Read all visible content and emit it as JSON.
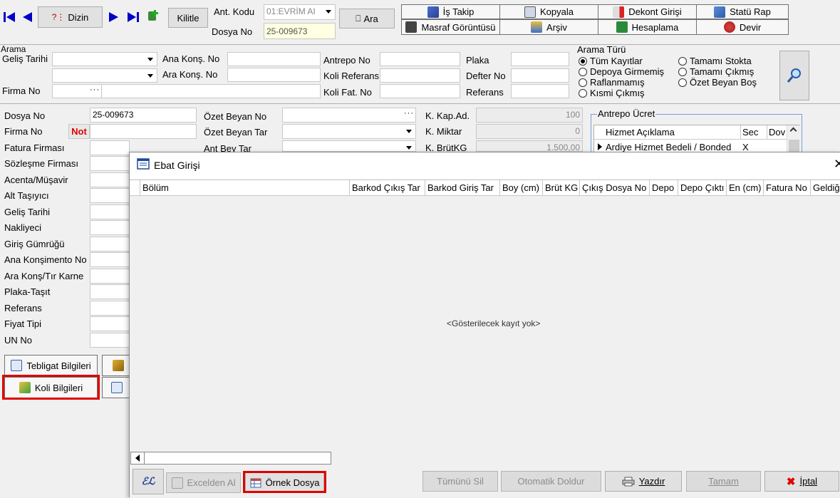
{
  "toolbar": {
    "dizin": "Dizin",
    "kilitle": "Kilitle",
    "ant_kodu_label": "Ant. Kodu",
    "ant_kodu_value": "01:EVRİM AI",
    "dosya_no_label": "Dosya No",
    "dosya_no_value": "25-009673",
    "ara": "Ara",
    "actions": {
      "is_takip": "İş Takip",
      "kopyala": "Kopyala",
      "dekont_girisi": "Dekont Girişi",
      "statu_rap": "Statü Rap",
      "masraf_goruntusu": "Masraf Görüntüsü",
      "arsiv": "Arşiv",
      "hesaplama": "Hesaplama",
      "devir": "Devir"
    }
  },
  "search": {
    "title": "Arama",
    "gelis_tarihi": "Geliş Tarihi",
    "firma_no": "Firma No",
    "ana_kons_no": "Ana Konş. No",
    "ara_kons_no": "Ara Konş. No",
    "antrepo_no": "Antrepo No",
    "koli_referans": "Koli Referans",
    "koli_fat_no": "Koli Fat. No",
    "plaka": "Plaka",
    "defter_no": "Defter No",
    "referans": "Referans",
    "arama_turu": {
      "title": "Arama Türü",
      "options": [
        "Tüm Kayıtlar",
        "Depoya Girmemiş",
        "Raflanmamış",
        "Kısmi Çıkmış",
        "Tamamı Stokta",
        "Tamamı Çıkmış",
        "Özet Beyan Boş"
      ],
      "selected": "Tüm Kayıtlar"
    }
  },
  "form": {
    "labels": [
      "Dosya No",
      "Firma No",
      "Fatura Firması",
      "Sözleşme Firması",
      "Acenta/Müşavir",
      "Alt Taşıyıcı",
      "Geliş Tarihi",
      "Nakliyeci",
      "Giriş Gümrüğü",
      "Ana Konşimento No",
      "Ara Konş/Tır Karne",
      "Plaka-Taşıt",
      "Referans",
      "Fiyat Tipi",
      "UN No"
    ],
    "dosya_no_value": "25-009673",
    "not_badge": "Not",
    "ozet_beyan_no": "Özet Beyan No",
    "ozet_beyan_tar": "Özet Beyan Tar",
    "ant_bey_tar": "Ant Bey Tar",
    "k_kap_ad": "K. Kap.Ad.",
    "k_kap_ad_value": "100",
    "k_miktar": "K. Miktar",
    "k_miktar_value": "0",
    "k_brutkg": "K. BrütKG",
    "k_brutkg_value": "1.500,00",
    "tebligat_bilgileri": "Tebligat Bilgileri",
    "koli_bilgileri": "Koli Bilgileri"
  },
  "antrepo_ucret": {
    "title": "Antrepo Ücret",
    "columns": [
      "Hizmet Açıklama",
      "Sec",
      "Dov"
    ],
    "rows": [
      {
        "hizmet": "Ardiye Hizmet Bedeli / Bonded",
        "sec": "X"
      }
    ]
  },
  "modal": {
    "title": "Ebat Girişi",
    "columns": [
      "Bölüm",
      "Barkod Çıkış Tar",
      "Barkod Giriş Tar",
      "Boy (cm)",
      "Brüt KG",
      "Çıkış Dosya No",
      "Depo",
      "Depo Çıktı",
      "En (cm)",
      "Fatura No",
      "Geldiğ"
    ],
    "empty_text": "<Gösterilecek kayıt yok>",
    "buttons": {
      "excelden_al": "Excelden Al",
      "ornek_dosya": "Örnek Dosya",
      "tumunu_sil": "Tümünü Sil",
      "otomatik_doldur": "Otomatik Doldur",
      "yazdir": "Yazdır",
      "tamam": "Tamam",
      "iptal": "İptal"
    }
  },
  "colors": {
    "highlight": "#e00000",
    "nav_blue": "#0000c8"
  }
}
